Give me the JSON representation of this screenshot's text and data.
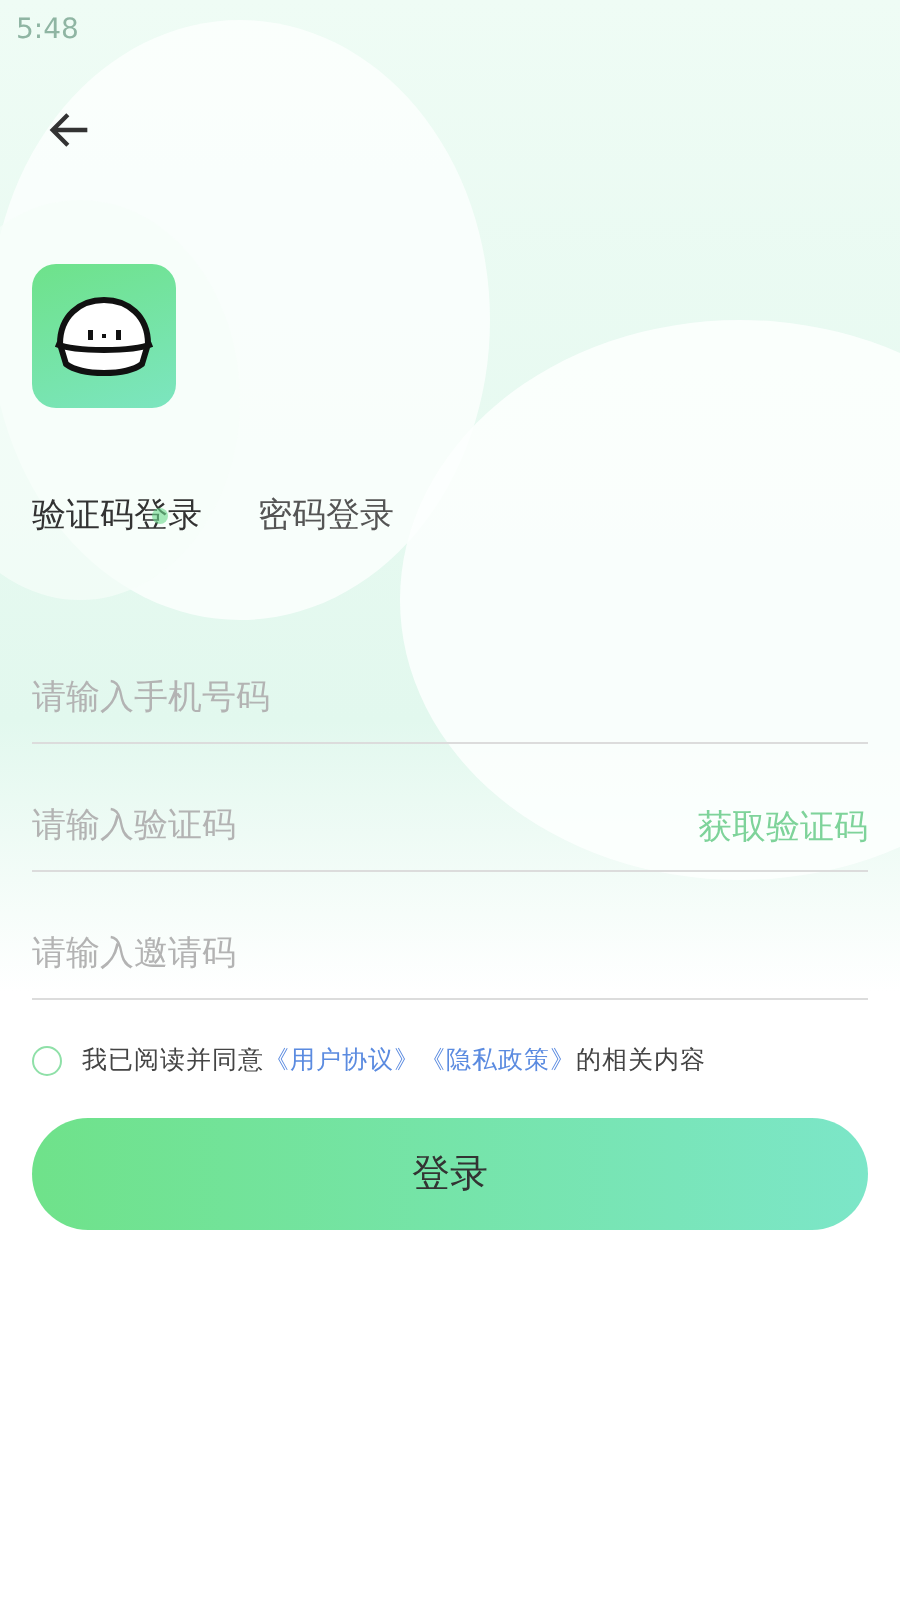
{
  "status_bar": {
    "time": "5:48"
  },
  "tabs": [
    {
      "label": "验证码登录",
      "selected": true
    },
    {
      "label": "密码登录",
      "selected": false
    }
  ],
  "fields": [
    {
      "placeholder": "请输入手机号码"
    },
    {
      "placeholder": "请输入验证码",
      "action": "获取验证码"
    },
    {
      "placeholder": "请输入邀请码"
    }
  ],
  "agreement": {
    "checked": false,
    "parts": [
      {
        "kind": "text",
        "text": "我已阅读并同意"
      },
      {
        "kind": "link",
        "text": "《用户协议》"
      },
      {
        "kind": "link",
        "text": "《隐私政策》"
      },
      {
        "kind": "text",
        "text": "的相关内容"
      }
    ]
  },
  "login_button": "登录"
}
